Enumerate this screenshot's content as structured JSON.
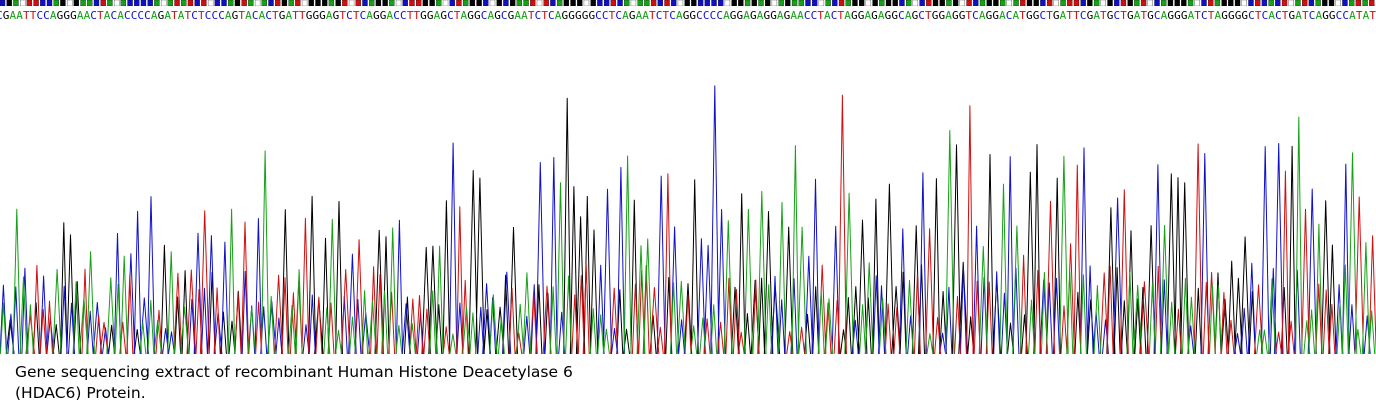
{
  "chart_data": {
    "type": "line",
    "sequence": "CGAATTCCAGGGAACTACACCCCAGATATCTCCCAGTACACTGATTGGGAGTCTCAGGACCTTGGAGCTAGGCAGCGAATCTCAGGGGGCCTCAGAATCTCAGGCCCCAGGAGAGGAGAACCTACTAGGAGAGGCAGCTGGAGGTCAGGACATGGCTGATTCGATGCTGATGCAGGGATCTAGGGGCTCACTGATCAGGCCATAT",
    "series": [
      {
        "base": "A",
        "color": "#16a116"
      },
      {
        "base": "C",
        "color": "#1010c8"
      },
      {
        "base": "G",
        "color": "#000000"
      },
      {
        "base": "T",
        "color": "#d01010"
      }
    ],
    "grid": false
  },
  "caption": "Gene sequencing extract of recombinant Human Histone Deacetylase 6\n(HDAC6) Protein."
}
